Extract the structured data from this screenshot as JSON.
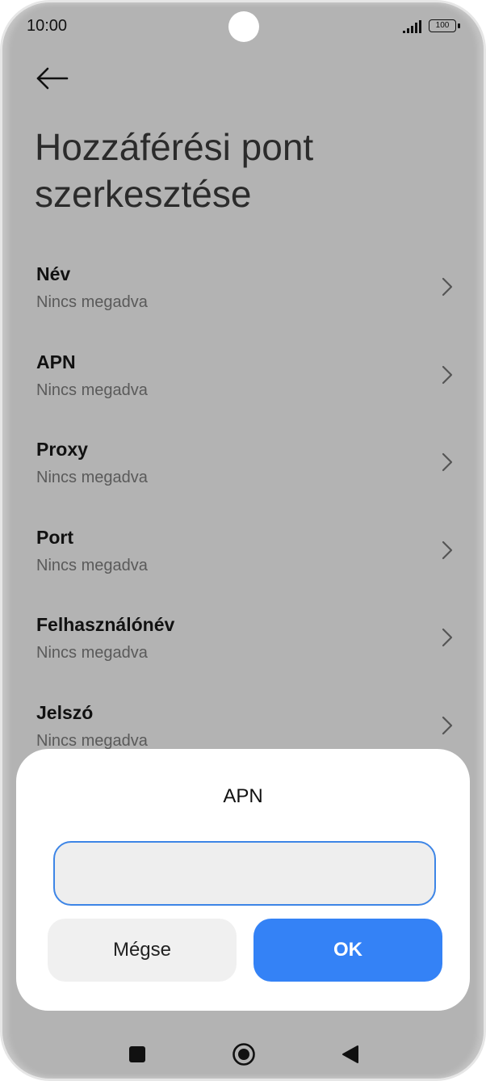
{
  "status_bar": {
    "time": "10:00",
    "battery": "100",
    "icons": [
      "signal-icon",
      "battery-icon"
    ]
  },
  "header": {
    "back_icon": "arrow-left-icon",
    "title": "Hozzáférési pont szerkesztése"
  },
  "settings": {
    "items": [
      {
        "label": "Név",
        "value": "Nincs megadva"
      },
      {
        "label": "APN",
        "value": "Nincs megadva"
      },
      {
        "label": "Proxy",
        "value": "Nincs megadva"
      },
      {
        "label": "Port",
        "value": "Nincs megadva"
      },
      {
        "label": "Felhasználónév",
        "value": "Nincs megadva"
      },
      {
        "label": "Jelszó",
        "value": "Nincs megadva"
      }
    ]
  },
  "dialog": {
    "title": "APN",
    "input_value": "",
    "cancel_label": "Mégse",
    "ok_label": "OK"
  },
  "nav_bar": {
    "icons": [
      "recents-square-icon",
      "home-circle-icon",
      "back-triangle-icon"
    ]
  },
  "colors": {
    "accent": "#3482f6",
    "input_border": "#3d85e6",
    "scrim_background": "#b3b3b3",
    "dialog_background": "#ffffff"
  }
}
